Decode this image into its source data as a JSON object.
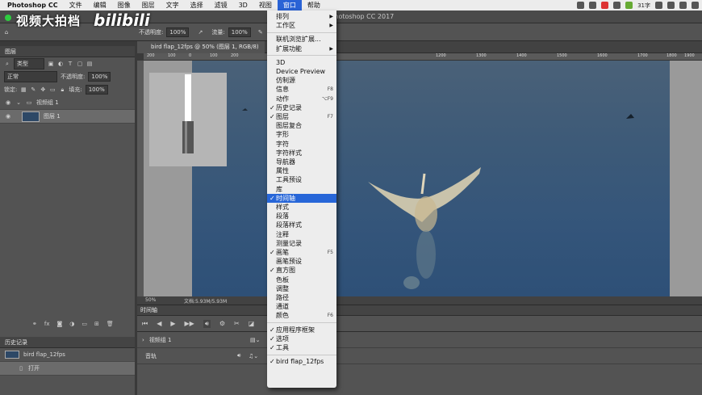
{
  "menubar": {
    "app": "Photoshop CC",
    "items": [
      "文件",
      "编辑",
      "图像",
      "图层",
      "文字",
      "选择",
      "滤镜",
      "3D",
      "视图",
      "窗口",
      "帮助"
    ],
    "active_index": 9,
    "status_text": "31字"
  },
  "window": {
    "title": "Adobe Photoshop CC 2017"
  },
  "watermark": {
    "text": "视频大拍档",
    "logo": "bilibili"
  },
  "options": {
    "opacity_label": "不透明度:",
    "opacity_value": "100%",
    "flow_label": "流量:",
    "flow_value": "100%"
  },
  "layers_panel": {
    "tab": "图层",
    "kind": "类型",
    "blend": "正常",
    "opacity_label": "不透明度:",
    "opacity_value": "100%",
    "lock_label": "锁定:",
    "fill_label": "填充:",
    "fill_value": "100%",
    "layers": [
      {
        "name": "视频组 1"
      },
      {
        "name": "图层 1"
      }
    ]
  },
  "history_panel": {
    "tab": "历史记录",
    "snapshot": "bird flap_12fps",
    "open": "打开"
  },
  "document": {
    "tab": "bird flap_12fps @ 50% (图层 1, RGB/8)",
    "zoom": "50%",
    "doc_info": "文档:5.93M/5.93M",
    "ruler_ticks": [
      "200",
      "100",
      "0",
      "100",
      "200",
      "1200",
      "1300",
      "1400",
      "1500",
      "1600",
      "1700",
      "1800",
      "1900",
      "2000"
    ]
  },
  "timeline": {
    "tab": "时间轴",
    "group": "视频组 1",
    "audio": "音轨"
  },
  "window_menu": {
    "items": [
      {
        "label": "排列",
        "submenu": true
      },
      {
        "label": "工作区",
        "submenu": true
      },
      {
        "sep": true
      },
      {
        "label": "联机浏览扩展..."
      },
      {
        "label": "扩展功能",
        "submenu": true
      },
      {
        "sep": true
      },
      {
        "label": "3D"
      },
      {
        "label": "Device Preview"
      },
      {
        "label": "仿制源"
      },
      {
        "label": "信息",
        "shortcut": "F8"
      },
      {
        "label": "动作",
        "shortcut": "⌥F9"
      },
      {
        "label": "历史记录",
        "checked": true
      },
      {
        "label": "图层",
        "checked": true,
        "shortcut": "F7"
      },
      {
        "label": "图层复合"
      },
      {
        "label": "字形"
      },
      {
        "label": "字符"
      },
      {
        "label": "字符样式"
      },
      {
        "label": "导航器"
      },
      {
        "label": "属性"
      },
      {
        "label": "工具预设"
      },
      {
        "label": "库"
      },
      {
        "label": "时间轴",
        "checked": true,
        "highlighted": true
      },
      {
        "label": "样式"
      },
      {
        "label": "段落"
      },
      {
        "label": "段落样式"
      },
      {
        "label": "注释"
      },
      {
        "label": "测量记录"
      },
      {
        "label": "画笔",
        "checked": true,
        "shortcut": "F5"
      },
      {
        "label": "画笔预设"
      },
      {
        "label": "直方图",
        "checked": true
      },
      {
        "label": "色板"
      },
      {
        "label": "调整"
      },
      {
        "label": "路径"
      },
      {
        "label": "通道"
      },
      {
        "label": "颜色",
        "shortcut": "F6"
      },
      {
        "sep": true
      },
      {
        "label": "应用程序框架",
        "checked": true
      },
      {
        "label": "选项",
        "checked": true
      },
      {
        "label": "工具",
        "checked": true
      },
      {
        "sep": true
      },
      {
        "label": "bird flap_12fps",
        "checked": true
      }
    ]
  }
}
